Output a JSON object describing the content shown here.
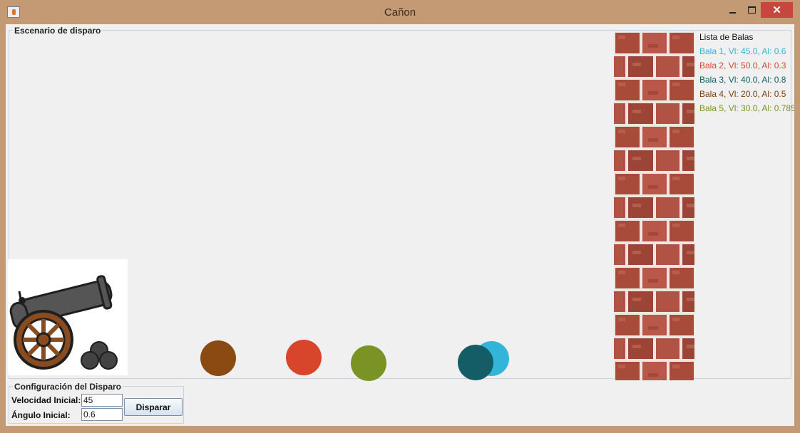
{
  "window": {
    "title": "Cañon",
    "controls": {
      "minimize_icon": "window-minimize-icon",
      "maximize_icon": "window-maximize-icon",
      "close_icon": "window-close-icon",
      "close_glyph": "✕"
    },
    "app_icon": "java-cup-icon"
  },
  "scenario": {
    "title": "Escenario de disparo",
    "cannon_icon": "cannon-icon",
    "wall_icon": "brick-wall-icon"
  },
  "bullet_list": {
    "title": "Lista de Balas",
    "items": [
      {
        "label": "Bala 1, Vl: 45.0, Al: 0.6",
        "color": "#33b5d9"
      },
      {
        "label": "Bala 2, Vl: 50.0, Al: 0.3",
        "color": "#d9452b"
      },
      {
        "label": "Bala 3, Vl: 40.0, Al: 0.8",
        "color": "#0f5f66"
      },
      {
        "label": "Bala 4, Vl: 20.0, Al: 0.5",
        "color": "#7a3d0c"
      },
      {
        "label": "Bala 5, Vl: 30.0, Al: 0.785",
        "color": "#7a9325"
      }
    ]
  },
  "balls": [
    {
      "name": "bala-4",
      "color": "#8a4a12"
    },
    {
      "name": "bala-2",
      "color": "#d9452b"
    },
    {
      "name": "bala-5",
      "color": "#7a9325"
    },
    {
      "name": "bala-1",
      "color": "#33b5d9"
    },
    {
      "name": "bala-3",
      "color": "#145d66"
    }
  ],
  "config": {
    "title": "Configuración del Disparo",
    "velocity_label": "Velocidad Inicial:",
    "velocity_value": "45",
    "angle_label": "Ángulo Inicial:",
    "angle_value": "0.6",
    "fire_button": "Disparar"
  }
}
